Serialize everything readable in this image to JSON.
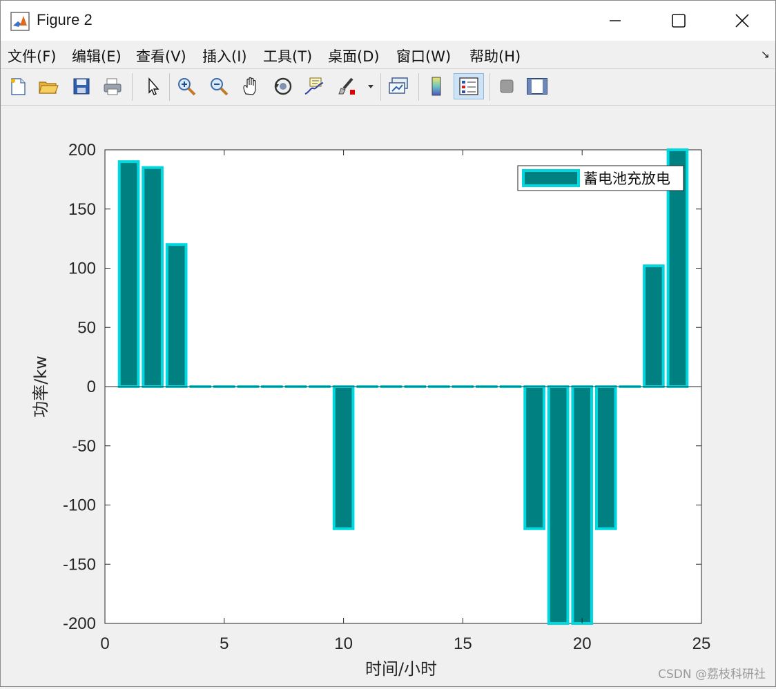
{
  "window": {
    "title": "Figure 2"
  },
  "menu": {
    "items": [
      "文件(F)",
      "编辑(E)",
      "查看(V)",
      "插入(I)",
      "工具(T)",
      "桌面(D)",
      "窗口(W)",
      "帮助(H)"
    ]
  },
  "toolbar": {
    "icons": [
      "new-figure-icon",
      "open-file-icon",
      "save-icon",
      "print-icon",
      "pointer-icon",
      "zoom-in-icon",
      "zoom-out-icon",
      "pan-icon",
      "rotate-3d-icon",
      "data-cursor-icon",
      "brush-icon",
      "link-plot-icon",
      "colorbar-icon",
      "legend-icon",
      "hide-plot-tools-icon",
      "show-plot-tools-icon"
    ]
  },
  "colors": {
    "bar_face": "#008080",
    "bar_edge": "#00d8e0",
    "axes_bg": "#ffffff"
  },
  "chart_data": {
    "type": "bar",
    "x": [
      1,
      2,
      3,
      4,
      5,
      6,
      7,
      8,
      9,
      10,
      11,
      12,
      13,
      14,
      15,
      16,
      17,
      18,
      19,
      20,
      21,
      22,
      23,
      24
    ],
    "series": [
      {
        "name": "蓄电池充放电",
        "values": [
          190,
          185,
          120,
          0,
          0,
          0,
          0,
          0,
          0,
          -120,
          0,
          0,
          0,
          0,
          0,
          0,
          0,
          -120,
          -200,
          -200,
          -120,
          0,
          102,
          200
        ]
      }
    ],
    "xlabel": "时间/小时",
    "ylabel": "功率/kw",
    "xlim": [
      0,
      25
    ],
    "ylim": [
      -200,
      200
    ],
    "xticks": [
      0,
      5,
      10,
      15,
      20,
      25
    ],
    "yticks": [
      -200,
      -150,
      -100,
      -50,
      0,
      50,
      100,
      150,
      200
    ],
    "legend_position": "top-right",
    "grid": false
  },
  "watermark": "CSDN @荔枝科研社"
}
